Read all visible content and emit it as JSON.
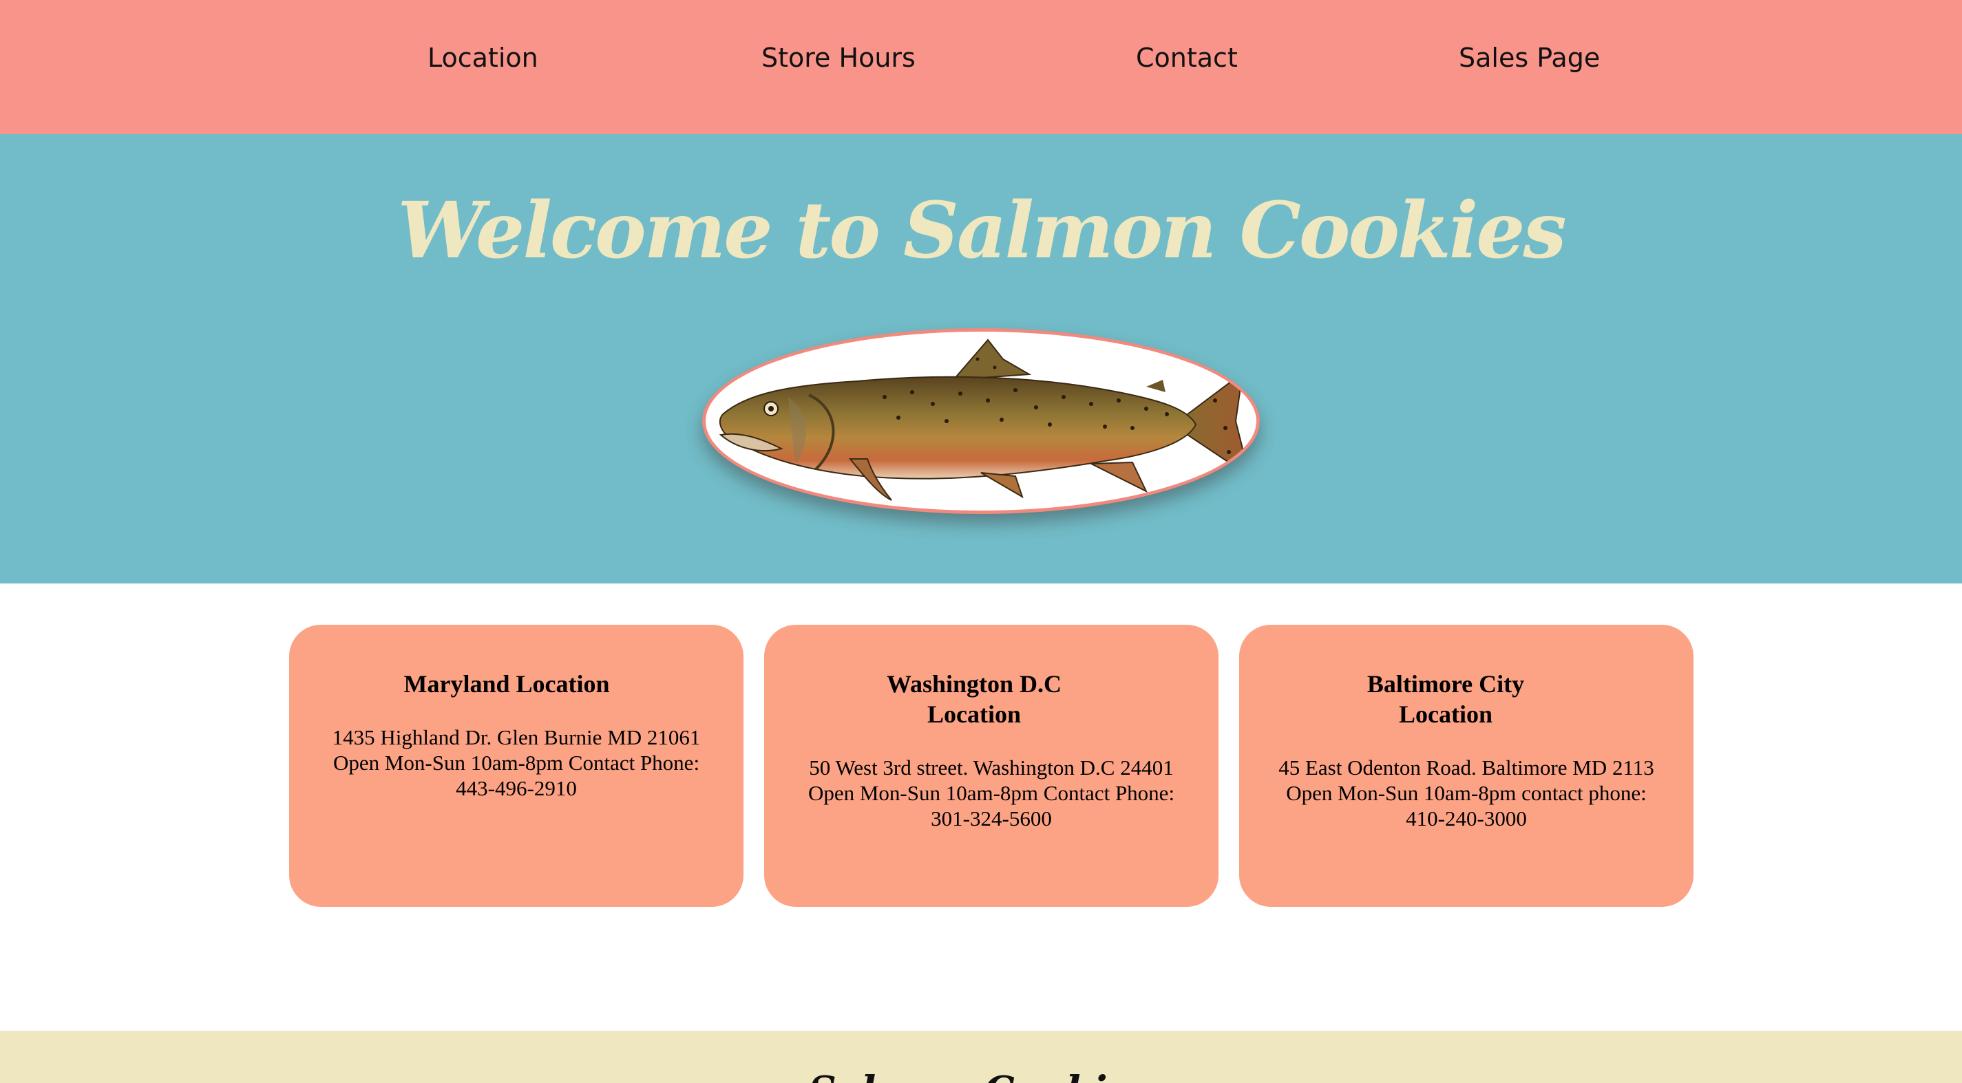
{
  "nav": {
    "items": [
      {
        "label": "Location"
      },
      {
        "label": "Store Hours"
      },
      {
        "label": "Contact"
      },
      {
        "label": "Sales Page"
      }
    ]
  },
  "hero": {
    "title": "Welcome to Salmon Cookies",
    "image_icon": "salmon-fish-image"
  },
  "locations": [
    {
      "title": "Maryland Location",
      "address": "1435 Highland Dr. Glen Burnie MD 21061 Open Mon-Sun 10am-8pm Contact Phone: 443-496-2910"
    },
    {
      "title": "Washington D.C Location",
      "address": "50 West 3rd street. Washington D.C 24401 Open Mon-Sun 10am-8pm Contact Phone: 301-324-5600"
    },
    {
      "title": "Baltimore City Location",
      "address": "45 East Odenton Road. Baltimore MD 2113 Open Mon-Sun 10am-8pm contact phone: 410-240-3000"
    }
  ],
  "footer": {
    "heading": "Salmon Cookies"
  },
  "colors": {
    "nav_bg": "#f9948b",
    "hero_bg": "#71bcc8",
    "title_color": "#efe7bf",
    "card_bg": "#fca386",
    "footer_bg": "#efe7bf"
  }
}
